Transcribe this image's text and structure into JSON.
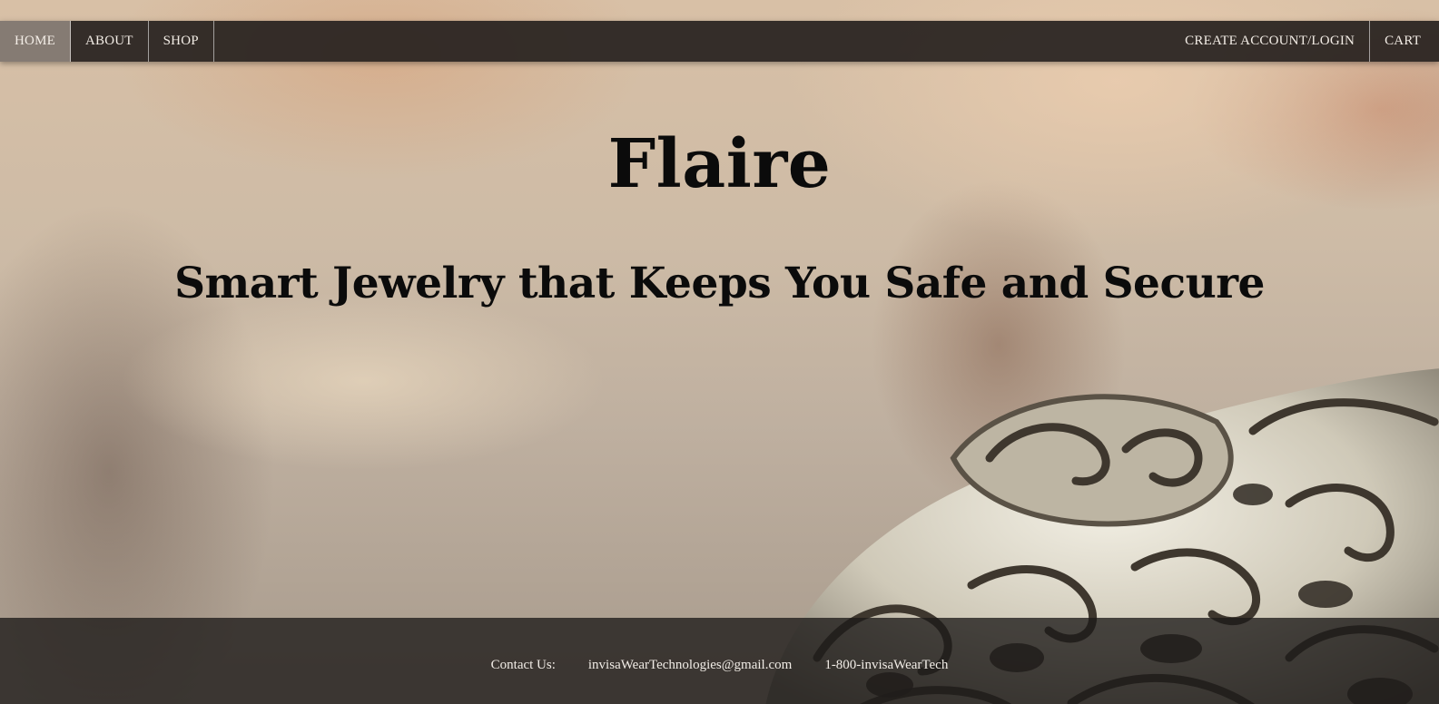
{
  "nav": {
    "left": [
      {
        "label": "HOME",
        "active": true
      },
      {
        "label": "ABOUT",
        "active": false
      },
      {
        "label": "SHOP",
        "active": false
      }
    ],
    "right": [
      {
        "label": "CREATE ACCOUNT/LOGIN"
      },
      {
        "label": "CART"
      }
    ]
  },
  "hero": {
    "title": "Flaire",
    "tagline": "Smart Jewelry that Keeps You Safe and Secure"
  },
  "footer": {
    "contact_label": "Contact Us:",
    "email": "invisaWearTechnologies@gmail.com",
    "phone": "1-800-invisaWearTech"
  },
  "colors": {
    "navbar": "#26211e",
    "text_dark": "#0b0b0b",
    "text_light": "#f3ede6",
    "active_tab": "#a0968c"
  }
}
